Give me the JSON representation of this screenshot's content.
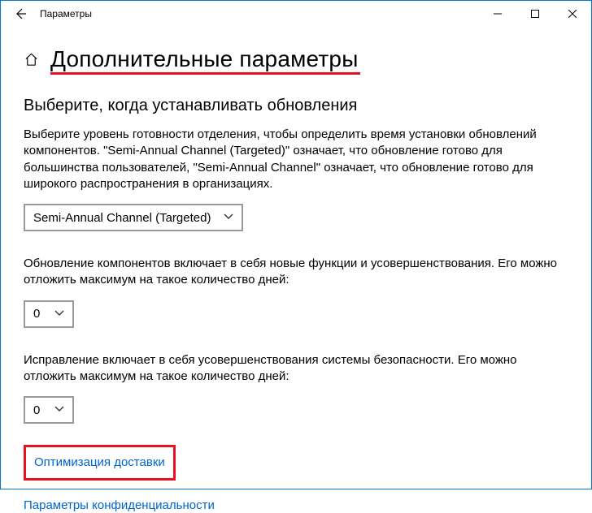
{
  "window": {
    "title": "Параметры"
  },
  "header": {
    "page_title": "Дополнительные параметры"
  },
  "section": {
    "subheading": "Выберите, когда устанавливать обновления",
    "paragraph1": "Выберите уровень готовности отделения, чтобы определить время установки обновлений компонентов. \"Semi-Annual Channel (Targeted)\" означает, что обновление готово для большинства пользователей, \"Semi-Annual Channel\" означает, что обновление готово для широкого распространения в организациях.",
    "channel_select": "Semi-Annual Channel (Targeted)",
    "paragraph2": "Обновление компонентов включает в себя новые функции и усовершенствования. Его можно отложить максимум на такое количество дней:",
    "feature_defer": "0",
    "paragraph3": "Исправление включает в себя усовершенствования системы безопасности. Его можно отложить максимум на такое количество дней:",
    "quality_defer": "0"
  },
  "links": {
    "delivery_optimization": "Оптимизация доставки",
    "privacy_settings": "Параметры конфиденциальности"
  }
}
